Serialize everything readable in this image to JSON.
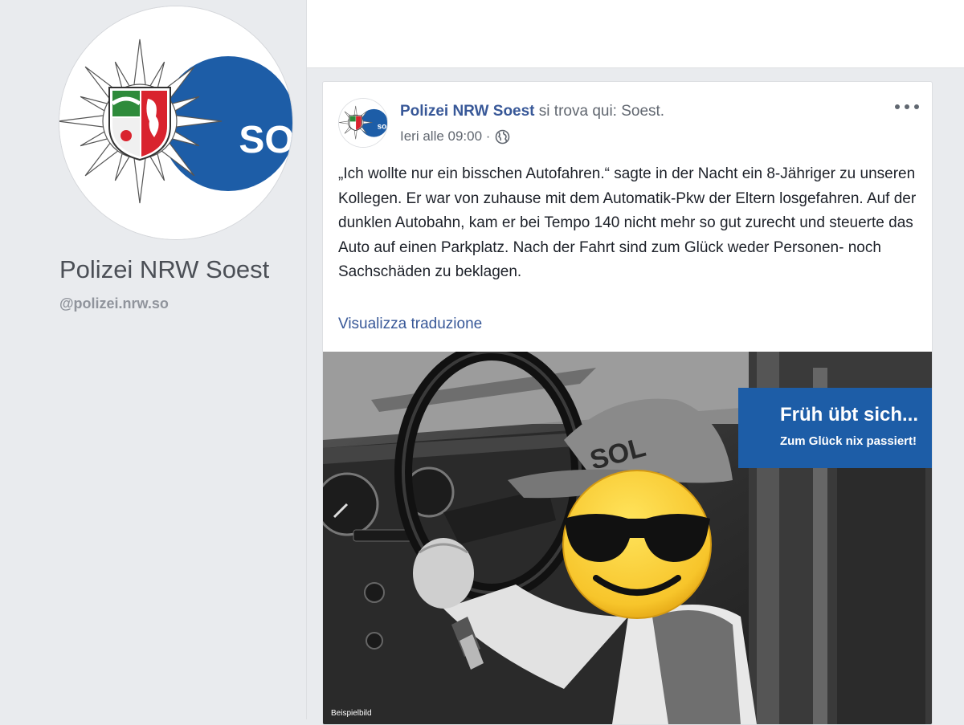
{
  "profile": {
    "name": "Polizei NRW Soest",
    "handle": "@polizei.nrw.so",
    "logo_icon": "nrw-police-star-logo",
    "logo_text": "SO"
  },
  "post": {
    "author": "Polizei NRW Soest",
    "location_text": " si trova qui: Soest.",
    "timestamp": "Ieri alle 09:00 ·",
    "privacy_icon": "globe-icon",
    "options_icon": "more-options-icon",
    "text": "„Ich wollte nur ein bisschen Autofahren.“ sagte in der Nacht ein 8-Jähriger zu unseren Kollegen. Er war von zuhause mit dem Automatik-Pkw der Eltern losgefahren. Auf der dunklen Autobahn, kam er bei Tempo 140 nicht mehr so gut zurecht und steuerte das Auto auf einen Parkplatz. Nach der Fahrt sind zum Glück weder Personen- noch Sachschäden zu beklagen.",
    "translate_label": "Visualizza traduzione",
    "image": {
      "banner_title": "Früh übt sich...",
      "banner_subtitle": "Zum Glück nix passiert!",
      "caption": "Beispielbild"
    }
  },
  "colors": {
    "page_background": "#e9ebee",
    "link_blue": "#385898",
    "police_blue": "#1d5da7",
    "emoji_yellow": "#f7c52b"
  }
}
